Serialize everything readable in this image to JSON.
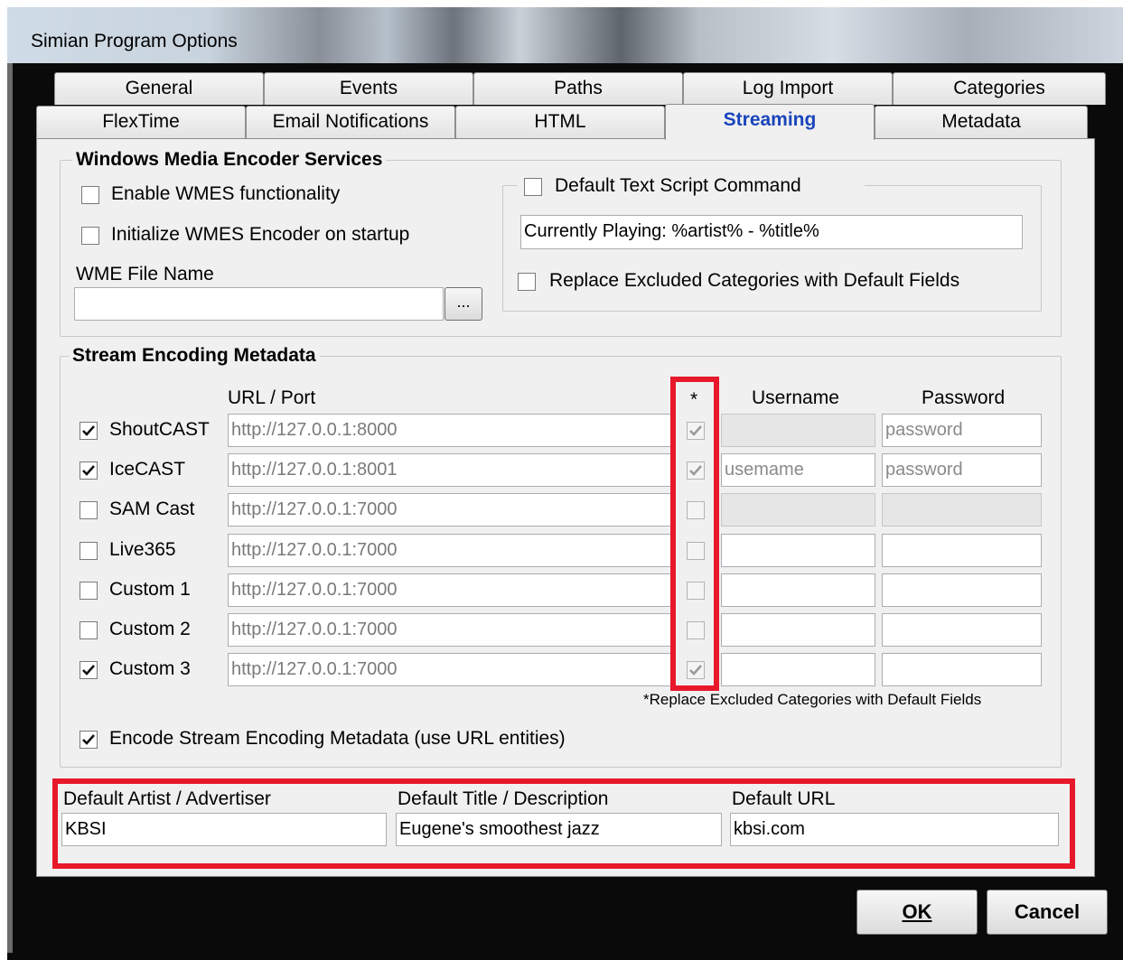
{
  "window": {
    "title": "Simian Program Options"
  },
  "tabs": {
    "row1": [
      "General",
      "Events",
      "Paths",
      "Log Import",
      "Categories"
    ],
    "row2": [
      "FlexTime",
      "Email Notifications",
      "HTML",
      "Streaming",
      "Metadata"
    ],
    "selected": "Streaming"
  },
  "wmes": {
    "group_title": "Windows Media Encoder Services",
    "enable_label": "Enable WMES functionality",
    "enable_checked": false,
    "init_label": "Initialize WMES Encoder on startup",
    "init_checked": false,
    "file_label": "WME File Name",
    "file_value": "",
    "browse_label": "...",
    "script_group_title": "Default Text Script Command",
    "script_checked": false,
    "script_value": "Currently Playing: %artist% - %title%",
    "replace_label": "Replace Excluded Categories with Default Fields",
    "replace_checked": false
  },
  "stream": {
    "group_title": "Stream Encoding Metadata",
    "headers": {
      "url": "URL / Port",
      "star": "*",
      "username": "Username",
      "password": "Password"
    },
    "rows": [
      {
        "name": "ShoutCAST",
        "checked": true,
        "url": "http://127.0.0.1:8000",
        "star": true,
        "username": "",
        "password": "password",
        "user_disabled": true,
        "pass_disabled": false
      },
      {
        "name": "IceCAST",
        "checked": true,
        "url": "http://127.0.0.1:8001",
        "star": true,
        "username": "usemame",
        "password": "password",
        "user_disabled": false,
        "pass_disabled": false
      },
      {
        "name": "SAM Cast",
        "checked": false,
        "url": "http://127.0.0.1:7000",
        "star": false,
        "username": "",
        "password": "",
        "user_disabled": true,
        "pass_disabled": true
      },
      {
        "name": "Live365",
        "checked": false,
        "url": "http://127.0.0.1:7000",
        "star": false,
        "username": "",
        "password": "",
        "user_disabled": false,
        "pass_disabled": false
      },
      {
        "name": "Custom 1",
        "checked": false,
        "url": "http://127.0.0.1:7000",
        "star": false,
        "username": "",
        "password": "",
        "user_disabled": false,
        "pass_disabled": false
      },
      {
        "name": "Custom 2",
        "checked": false,
        "url": "http://127.0.0.1:7000",
        "star": false,
        "username": "",
        "password": "",
        "user_disabled": false,
        "pass_disabled": false
      },
      {
        "name": "Custom 3",
        "checked": true,
        "url": "http://127.0.0.1:7000",
        "star": true,
        "username": "",
        "password": "",
        "user_disabled": false,
        "pass_disabled": false
      }
    ],
    "footnote": "*Replace Excluded Categories with Default Fields",
    "encode_label": "Encode Stream Encoding Metadata (use URL entities)",
    "encode_checked": true
  },
  "defaults": {
    "artist_label": "Default Artist / Advertiser",
    "artist_value": "KBSI",
    "title_label": "Default Title / Description",
    "title_value": "Eugene's smoothest jazz",
    "url_label": "Default URL",
    "url_value": "kbsi.com"
  },
  "buttons": {
    "ok": "OK",
    "cancel": "Cancel"
  },
  "colors": {
    "highlight": "#e8182b",
    "selected_tab": "#1a44bb"
  }
}
